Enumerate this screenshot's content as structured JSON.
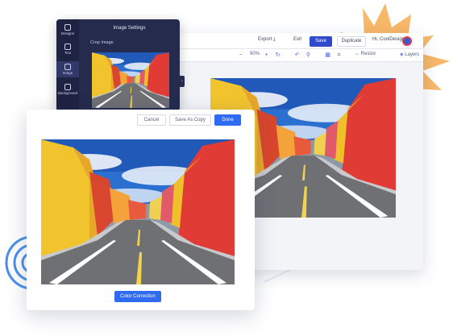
{
  "editor": {
    "topbar": {
      "export_label": "Export",
      "exit_label": "Exit",
      "save_label": "Save",
      "duplicate_label": "Duplicate",
      "greeting": "Hi, CoolDesigns"
    },
    "toolbar": {
      "zoom_level": "90%",
      "resize_label": "Resize",
      "layers_label": "Layers"
    }
  },
  "image_settings": {
    "title": "Image Settings",
    "crop_label": "Crop Image",
    "rail": [
      {
        "label": "Designs",
        "icon": "designs-icon",
        "active": false
      },
      {
        "label": "Text",
        "icon": "text-icon",
        "active": false
      },
      {
        "label": "Image",
        "icon": "image-icon",
        "active": true
      },
      {
        "label": "Background",
        "icon": "background-icon",
        "active": false
      }
    ]
  },
  "crop_modal": {
    "cancel_label": "Cancel",
    "save_copy_label": "Save As Copy",
    "done_label": "Done",
    "color_correction_label": "Color Correction"
  },
  "colors": {
    "accent": "#2f6bf0",
    "save_blue": "#2f4acb",
    "panel_dark": "#252b4d",
    "burst_orange": "#f7b86a",
    "arc_blue": "#4a90e8"
  }
}
